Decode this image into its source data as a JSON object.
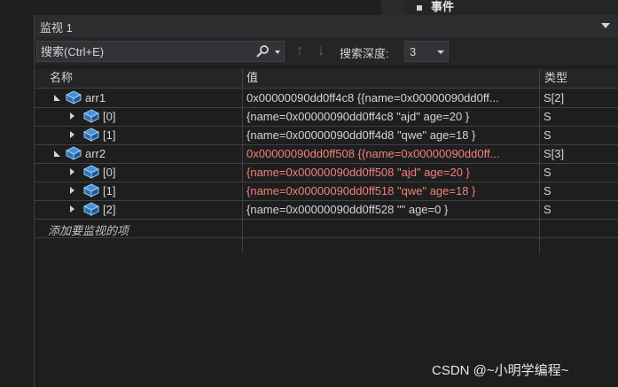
{
  "top": {
    "event_label": "事件"
  },
  "panel": {
    "title": "监视 1"
  },
  "toolbar": {
    "search_placeholder": "搜索(Ctrl+E)",
    "search_icon": "magnifier-icon",
    "depth_label": "搜索深度:",
    "depth_value": "3"
  },
  "headers": {
    "name": "名称",
    "value": "值",
    "type": "类型"
  },
  "rows": [
    {
      "name": "arr1",
      "value": "0x00000090dd0ff4c8 {{name=0x00000090dd0ff...",
      "type": "S[2]",
      "changed": false
    },
    {
      "name": "[0]",
      "value": "{name=0x00000090dd0ff4c8 \"ajd\" age=20 }",
      "type": "S",
      "changed": false
    },
    {
      "name": "[1]",
      "value": "{name=0x00000090dd0ff4d8 \"qwe\" age=18 }",
      "type": "S",
      "changed": false
    },
    {
      "name": "arr2",
      "value": "0x00000090dd0ff508 {{name=0x00000090dd0ff...",
      "type": "S[3]",
      "changed": true
    },
    {
      "name": "[0]",
      "value": "{name=0x00000090dd0ff508 \"ajd\" age=20 }",
      "type": "S",
      "changed": true
    },
    {
      "name": "[1]",
      "value": "{name=0x00000090dd0ff518 \"qwe\" age=18 }",
      "type": "S",
      "changed": true
    },
    {
      "name": "[2]",
      "value": "{name=0x00000090dd0ff528 \"\" age=0 }",
      "type": "S",
      "changed": false
    }
  ],
  "add_watch_label": "添加要监视的项",
  "watermark": "CSDN @~小明学编程~",
  "colors": {
    "changed_value": "#f1817c",
    "background": "#1e1e1e"
  }
}
